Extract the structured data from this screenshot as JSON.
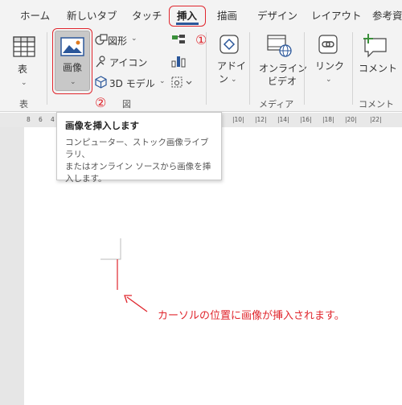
{
  "tabs": [
    {
      "label": "ホーム"
    },
    {
      "label": "新しいタブ"
    },
    {
      "label": "タッチ"
    },
    {
      "label": "挿入"
    },
    {
      "label": "描画"
    },
    {
      "label": "デザイン"
    },
    {
      "label": "レイアウト"
    },
    {
      "label": "参考資"
    }
  ],
  "ribbon": {
    "table": {
      "label": "表",
      "group": "表"
    },
    "image": {
      "label": "画像"
    },
    "shapes": {
      "label": "図形"
    },
    "icons": {
      "label": "アイコン"
    },
    "models3d": {
      "label": "3D モデル"
    },
    "figure_group": "図",
    "addins": {
      "label_line1": "アドイ",
      "label_line2": "ン"
    },
    "online_video": {
      "label_line1": "オンライン",
      "label_line2": "ビデオ"
    },
    "media_group": "メディア",
    "link": {
      "label": "リンク"
    },
    "comment": {
      "label": "コメント",
      "group": "コメント"
    }
  },
  "markers": {
    "one": "①",
    "two": "②"
  },
  "ruler": {
    "ticks": [
      "8",
      "6",
      "4",
      "2",
      "|10|",
      "|12|",
      "|14|",
      "|16|",
      "|18|",
      "|20|",
      "|22|"
    ]
  },
  "tooltip": {
    "title": "画像を挿入します",
    "desc_line1": "コンピューター、ストック画像ライブラリ、",
    "desc_line2": "またはオンライン ソースから画像を挿",
    "desc_line3": "入します。"
  },
  "annotation": "カーソルの位置に画像が挿入されます。",
  "colors": {
    "accent": "#2b579a",
    "highlight": "#e0262d",
    "pressed": "#c8c8c8"
  }
}
